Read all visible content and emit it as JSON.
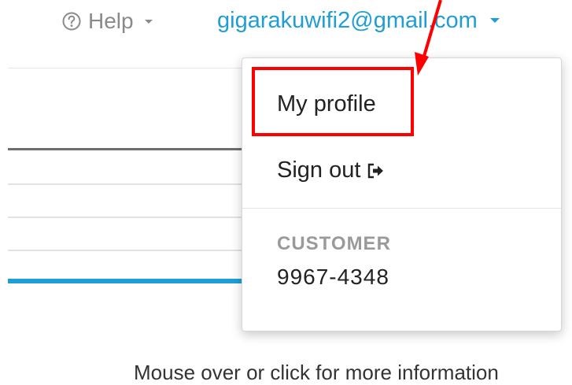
{
  "header": {
    "help_label": "Help",
    "account_email": "gigarakuwifi2@gmail.com"
  },
  "dropdown": {
    "my_profile": "My profile",
    "sign_out": "Sign out",
    "customer_label": "CUSTOMER",
    "customer_number": "9967-4348"
  },
  "footer": {
    "hint": "Mouse over or click for more information"
  },
  "colors": {
    "accent": "#1f9ed6",
    "annotation": "#ff0000"
  }
}
